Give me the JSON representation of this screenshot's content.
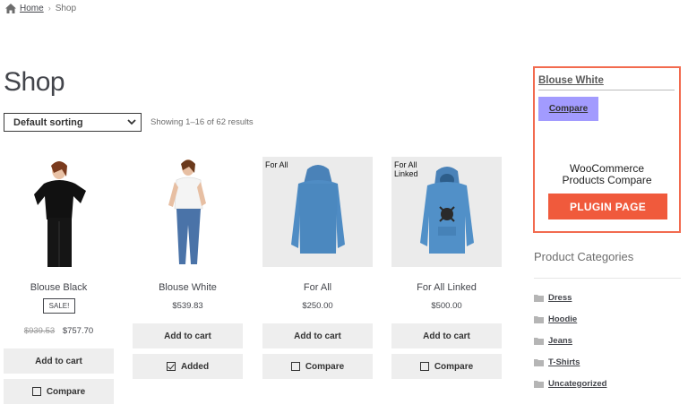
{
  "breadcrumb": {
    "home": "Home",
    "separator": "›",
    "current": "Shop"
  },
  "page_title": "Shop",
  "sorting": {
    "selected": "Default sorting"
  },
  "result_count": "Showing 1–16 of 62 results",
  "products": [
    {
      "name": "Blouse Black",
      "sale_badge": "SALE!",
      "old_price": "$939.53",
      "price": "$757.70",
      "tag": "",
      "add_to_cart": "Add to cart",
      "compare": "Compare"
    },
    {
      "name": "Blouse White",
      "price": "$539.83",
      "tag": "",
      "add_to_cart": "Add to cart",
      "compare": "Added",
      "compare_checked": true
    },
    {
      "name": "For All",
      "price": "$250.00",
      "tag": "For All",
      "add_to_cart": "Add to cart",
      "compare": "Compare"
    },
    {
      "name": "For All Linked",
      "price": "$500.00",
      "tag": "For All\nLinked",
      "add_to_cart": "Add to cart",
      "compare": "Compare"
    }
  ],
  "compare_widget": {
    "product_title": "Blouse White",
    "compare_button": "Compare",
    "promo_line1": "WooCommerce",
    "promo_line2": "Products Compare",
    "plugin_button": "PLUGIN PAGE",
    "border_color": "#f26b4f",
    "compare_button_color": "#a29bfe",
    "plugin_button_color": "#f05a3c"
  },
  "categories": {
    "title": "Product Categories",
    "items": [
      "Dress",
      "Hoodie",
      "Jeans",
      "T-Shirts",
      "Uncategorized"
    ]
  },
  "icons": {
    "home": "home-icon",
    "folder": "folder-icon",
    "checkbox": "checkbox-icon",
    "select_caret": "chevron-down-icon"
  }
}
